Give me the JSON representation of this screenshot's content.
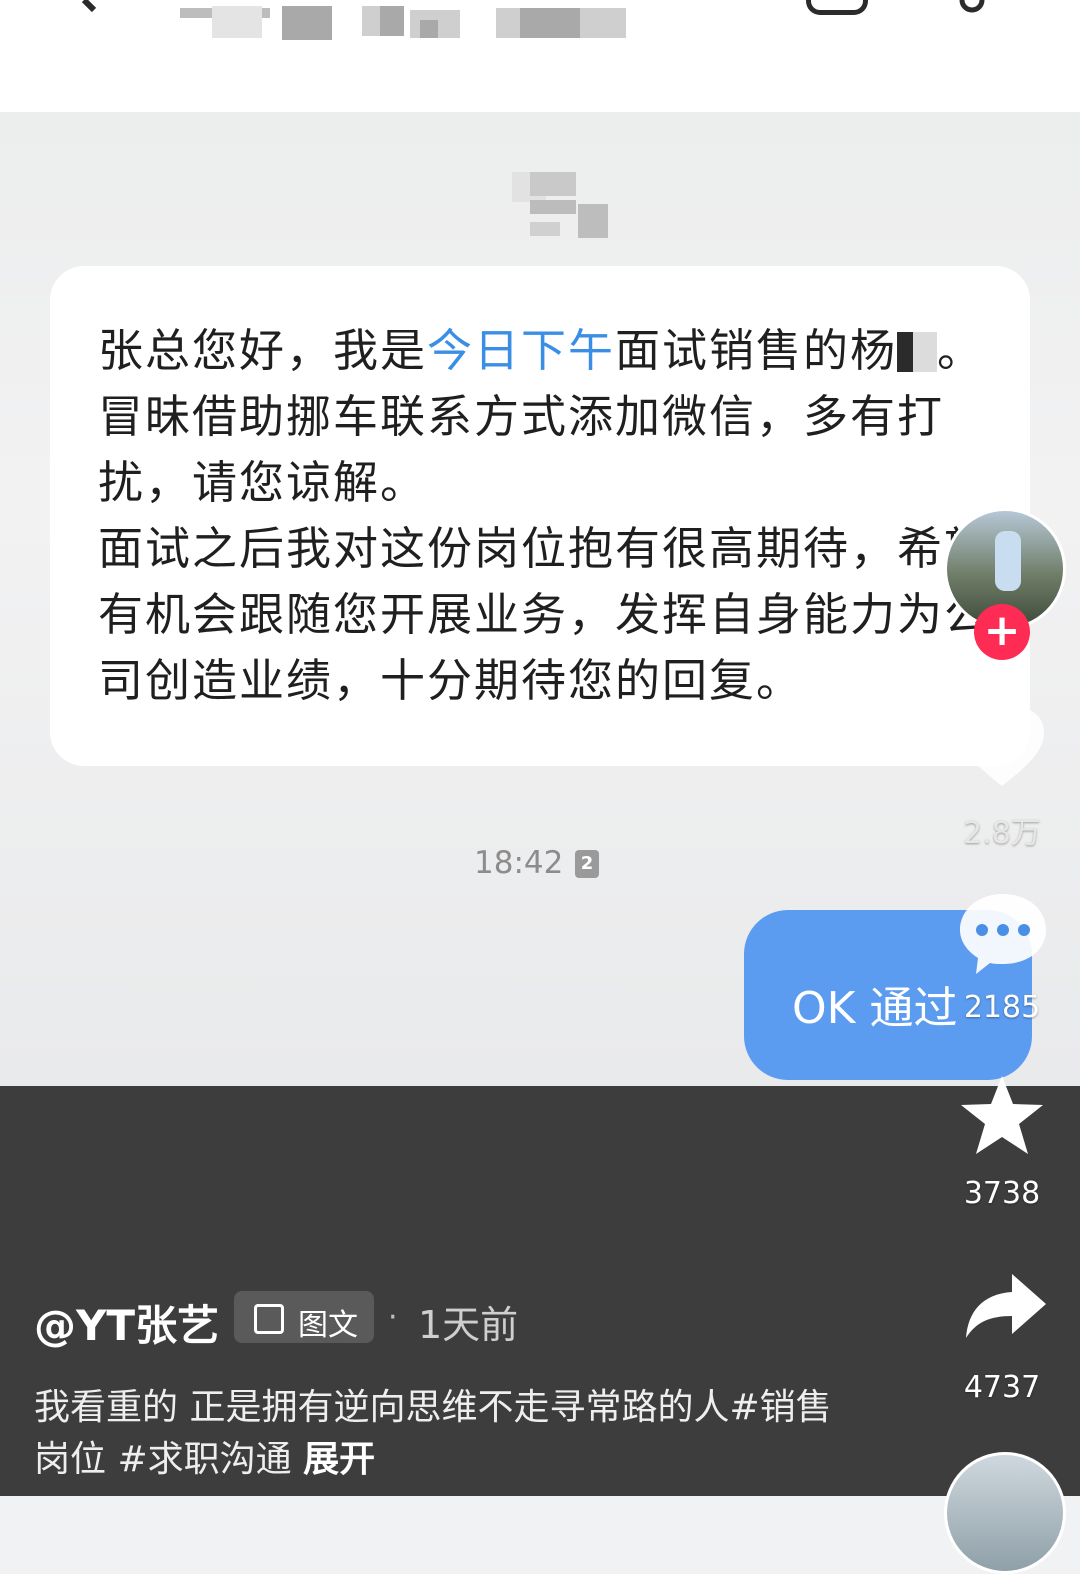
{
  "chat": {
    "message_part1": "张总您好，我是",
    "message_highlight": "今日下午",
    "message_part2": "面试销售的杨",
    "message_line2": "。冒昧借助挪车联系方式添加微信，多有打扰，请您谅解。",
    "message_para2": "面试之后我对这份岗位抱有很高期待，希望有机会跟随您开展业务，发挥自身能力为公司创造业绩，十分期待您的回复。",
    "time": "18:42",
    "receipt_badge": "2",
    "reply": "OK 通过"
  },
  "post": {
    "author": "@YT张艺",
    "type_tag": "图文",
    "separator": "·",
    "posted": "1天前",
    "description": "我看重的 正是拥有逆向思维不走寻常路的人#销售岗位 #求职沟通",
    "expand": "展开"
  },
  "actions": {
    "follow": "+",
    "like_count": "2.8万",
    "comment_count": "2185",
    "favorite_count": "3738",
    "share_count": "4737"
  },
  "colors": {
    "highlight": "#3a8ee6",
    "reply_bubble": "#5c9cf0",
    "follow_button": "#fe2c55"
  },
  "icons": [
    "back-icon",
    "profile-card-icon",
    "more-icon",
    "heart-icon",
    "comment-icon",
    "star-icon",
    "share-icon",
    "gallery-icon"
  ]
}
